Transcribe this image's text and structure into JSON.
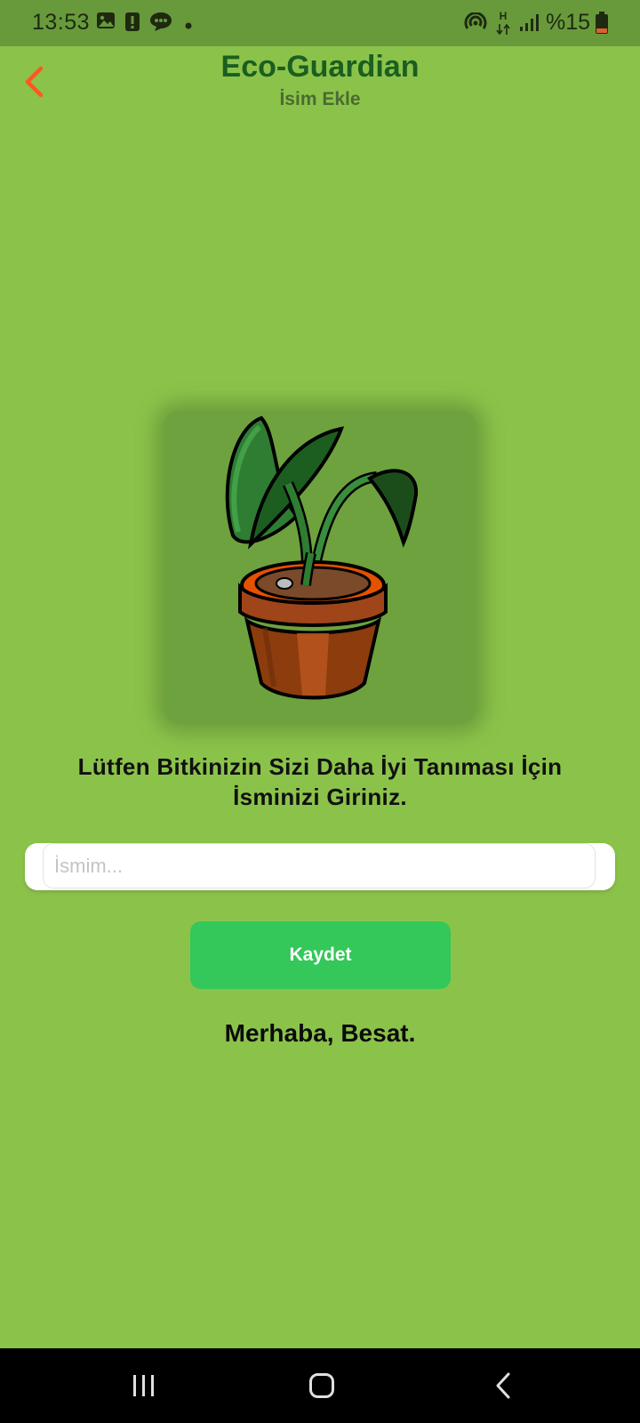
{
  "status_bar": {
    "time": "13:53",
    "battery_text": "%15",
    "network_type": "H",
    "icons": [
      "gallery-icon",
      "alert-icon",
      "message-icon",
      "dot-icon",
      "hotspot-icon",
      "data-arrows-icon",
      "signal-icon",
      "battery-icon"
    ]
  },
  "header": {
    "title": "Eco-Guardian",
    "subtitle": "İsim Ekle",
    "back_icon": "chevron-left-icon"
  },
  "main": {
    "illustration": "potted-plant-illustration",
    "prompt": "Lütfen Bitkinizin Sizi Daha İyi Tanıması İçin İsminizi Giriniz.",
    "name_input": {
      "value": "",
      "placeholder": "İsmim..."
    },
    "save_label": "Kaydet",
    "greeting": "Merhaba, Besat."
  },
  "nav_bar": {
    "icons": [
      "recents-icon",
      "home-icon",
      "back-icon"
    ]
  },
  "colors": {
    "background": "#8bc34a",
    "status_bar": "#689a3c",
    "title": "#1b5e20",
    "back_arrow": "#ff5722",
    "save_button": "#34c759",
    "card": "#6ea23e"
  }
}
